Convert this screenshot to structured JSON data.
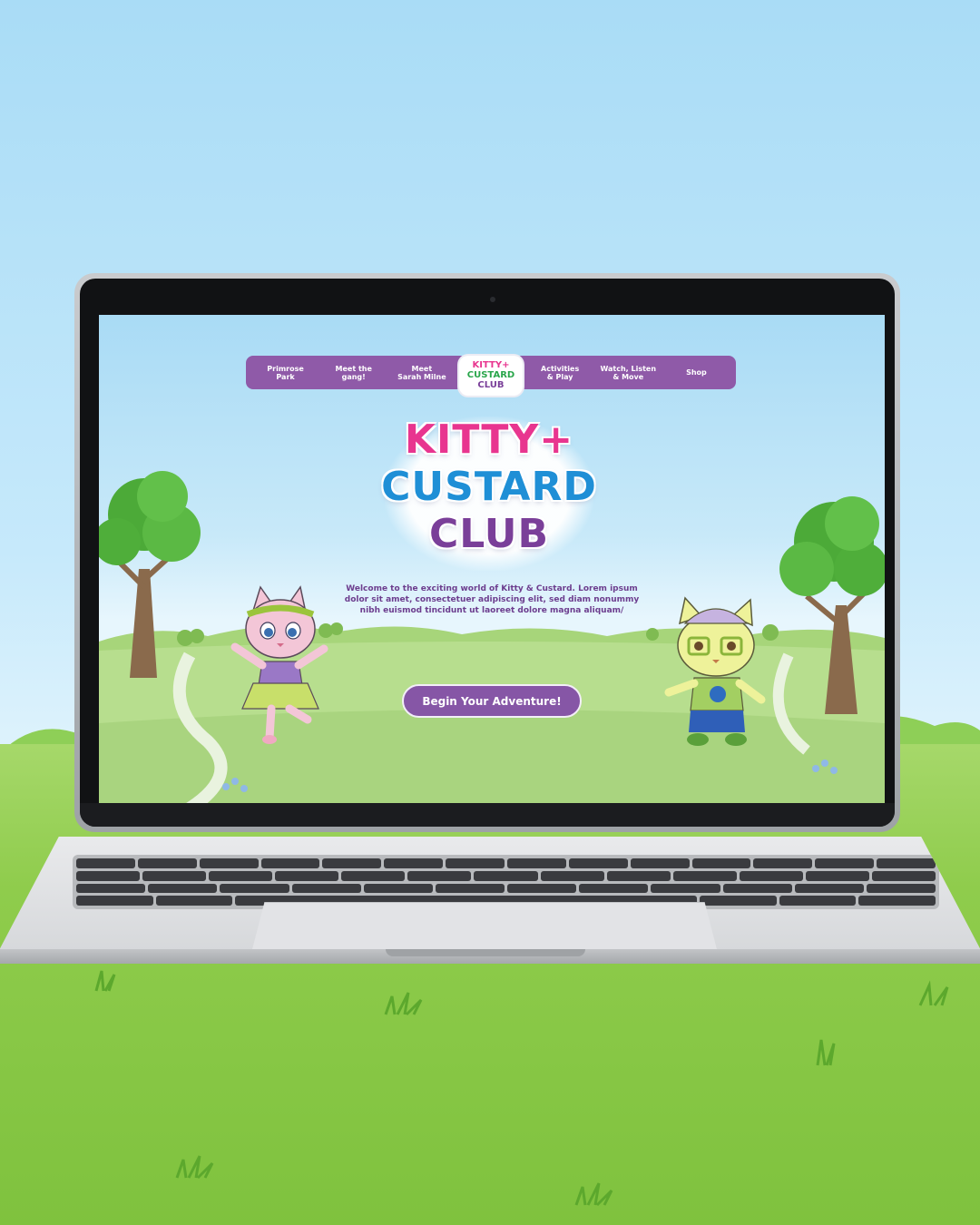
{
  "nav": {
    "items_left": [
      "Primrose\nPark",
      "Meet the\ngang!",
      "Meet\nSarah Milne"
    ],
    "items_right": [
      "Activities\n& Play",
      "Watch, Listen\n& Move",
      "Shop"
    ],
    "logo_lines": [
      "KITTY+",
      "CUSTARD",
      "CLUB"
    ]
  },
  "hero": {
    "logo_line1": "KITTY+",
    "logo_line2": "CUSTARD",
    "logo_line3": "CLUB",
    "welcome_text": "Welcome to the exciting world of Kitty & Custard. Lorem ipsum dolor sit amet, consectetuer adipiscing elit, sed diam nonummy nibh euismod tincidunt ut laoreet dolore magna aliquam/",
    "cta_label": "Begin Your Adventure!"
  },
  "colors": {
    "nav_purple": "#8f5aa8",
    "button_purple": "#8656a6",
    "text_purple": "#6c3d8e",
    "logo_pink": "#e8358f",
    "logo_green": "#2aa64b",
    "logo_yellow": "#f2b51a",
    "logo_blue": "#1f8fd6",
    "logo_red": "#e4433b",
    "logo_purple": "#7a3f99"
  },
  "icons": [
    "kitty-character",
    "custard-character",
    "tree-left",
    "tree-right"
  ]
}
